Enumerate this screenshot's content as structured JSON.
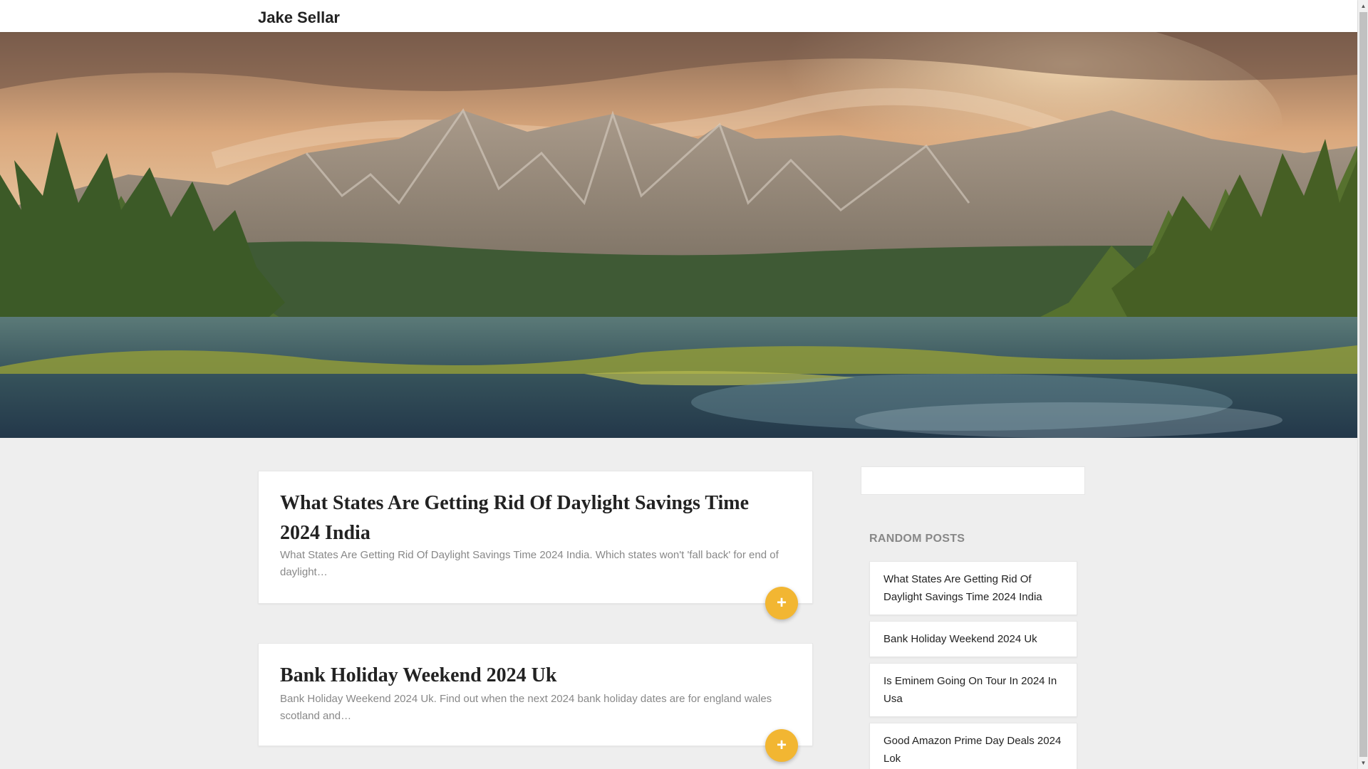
{
  "site": {
    "title": "Jake Sellar"
  },
  "posts": [
    {
      "title": "What States Are Getting Rid Of Daylight Savings Time 2024 India",
      "excerpt": "What States Are Getting Rid Of Daylight Savings Time 2024 India. Which states won't 'fall back' for end of daylight…",
      "more_label": "+"
    },
    {
      "title": "Bank Holiday Weekend 2024 Uk",
      "excerpt": "Bank Holiday Weekend 2024 Uk. Find out when the next 2024 bank holiday dates are for england wales scotland and…",
      "more_label": "+"
    }
  ],
  "sidebar": {
    "search": {
      "placeholder": "",
      "value": ""
    },
    "random_posts_title": "RANDOM POSTS",
    "random_posts": [
      "What States Are Getting Rid Of Daylight Savings Time 2024 India",
      "Bank Holiday Weekend 2024 Uk",
      "Is Eminem Going On Tour In 2024 In Usa",
      "Good Amazon Prime Day Deals 2024 Lok"
    ]
  },
  "colors": {
    "accent": "#f2b632",
    "background": "#eeeeee",
    "text": "#222222",
    "muted": "#888888"
  },
  "icons": {
    "more": "plus-icon",
    "scroll_up": "triangle-up-icon",
    "scroll_down": "triangle-down-icon"
  }
}
